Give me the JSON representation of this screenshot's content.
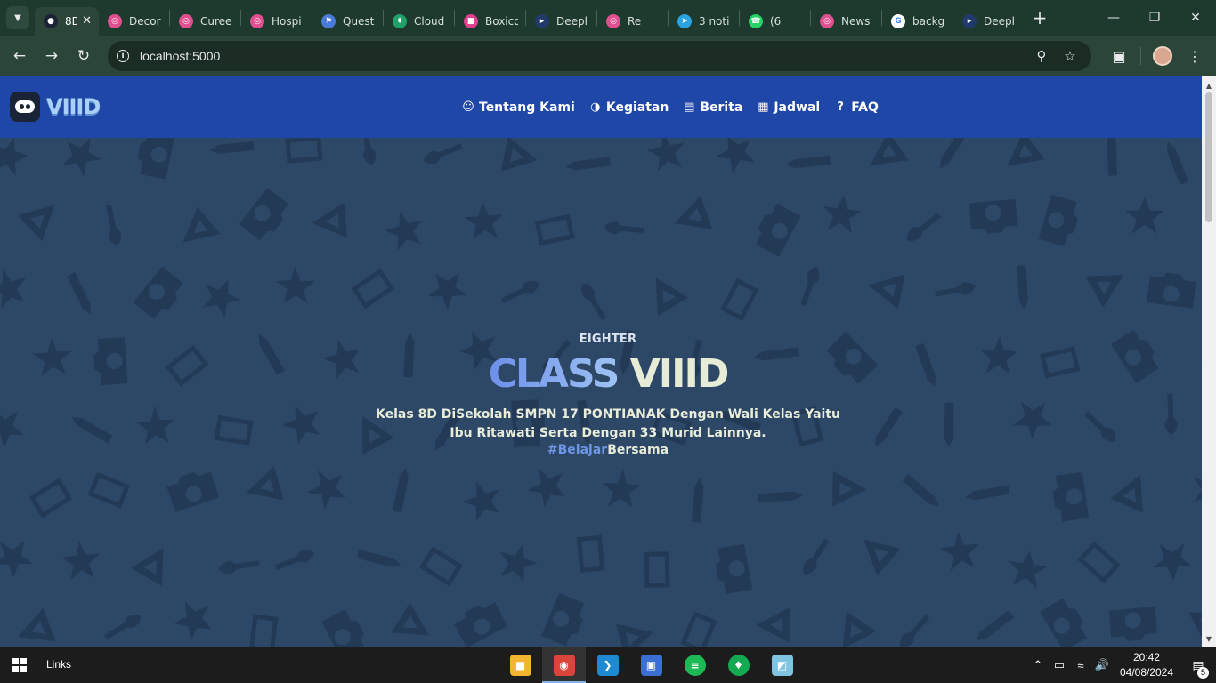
{
  "browser": {
    "tabs": [
      {
        "label": "8D",
        "color": "#1a2436",
        "glyph": "●",
        "active": true
      },
      {
        "label": "Decor",
        "color": "#e04f8f",
        "glyph": "◎"
      },
      {
        "label": "Curee",
        "color": "#e04f8f",
        "glyph": "◎"
      },
      {
        "label": "Hospi",
        "color": "#e04f8f",
        "glyph": "◎"
      },
      {
        "label": "Quest",
        "color": "#4b7bd8",
        "glyph": "⚑"
      },
      {
        "label": "Cloud",
        "color": "#22a06b",
        "glyph": "♦"
      },
      {
        "label": "Boxico",
        "color": "#e0408f",
        "glyph": "■"
      },
      {
        "label": "Deepl",
        "color": "#223a6a",
        "glyph": "▸"
      },
      {
        "label": "Re",
        "color": "#e04f8f",
        "glyph": "◎"
      },
      {
        "label": "3 noti",
        "color": "#2aa3e0",
        "glyph": "➤"
      },
      {
        "label": "(6",
        "color": "#25d366",
        "glyph": "☎"
      },
      {
        "label": "News",
        "color": "#e04f8f",
        "glyph": "◎"
      },
      {
        "label": "backg",
        "color": "#ffffff",
        "glyph": "G"
      },
      {
        "label": "Deepl",
        "color": "#223a6a",
        "glyph": "▸"
      }
    ],
    "url": "localhost:5000"
  },
  "site": {
    "logo_text": "VIIID",
    "menu": [
      {
        "icon": "☺",
        "label": "Tentang Kami",
        "name": "nav-tentang-kami"
      },
      {
        "icon": "◑",
        "label": "Kegiatan",
        "name": "nav-kegiatan"
      },
      {
        "icon": "▤",
        "label": "Berita",
        "name": "nav-berita"
      },
      {
        "icon": "▦",
        "label": "Jadwal",
        "name": "nav-jadwal"
      },
      {
        "icon": "?",
        "label": "FAQ",
        "name": "nav-faq"
      }
    ],
    "hero": {
      "eyebrow": "EIGHTER",
      "headline_1": "CLASS",
      "headline_2": "VIIID",
      "description": "Kelas 8D DiSekolah SMPN 17 PONTIANAK Dengan Wali Kelas Yaitu Ibu Ritawati Serta Dengan 33 Murid Lainnya.",
      "tag_1": "#Belajar",
      "tag_2": "Bersama"
    }
  },
  "taskbar": {
    "links_label": "Links",
    "apps": [
      {
        "name": "file-explorer",
        "color": "#f2b330",
        "glyph": "■"
      },
      {
        "name": "chrome",
        "color": "#d9453b",
        "glyph": "◉",
        "active": true
      },
      {
        "name": "vscode",
        "color": "#1f8ad2",
        "glyph": "❯"
      },
      {
        "name": "control-panel",
        "color": "#3b6fd1",
        "glyph": "▣"
      },
      {
        "name": "spotify",
        "color": "#1db954",
        "glyph": "≡"
      },
      {
        "name": "mongodb",
        "color": "#13aa52",
        "glyph": "♦"
      },
      {
        "name": "notes",
        "color": "#7fc4e0",
        "glyph": "◩"
      }
    ],
    "time": "20:42",
    "date": "04/08/2024",
    "notification_count": "5"
  },
  "colors": {
    "nav_bg": "#1f47a8",
    "hero_bg": "#2d4766",
    "accent": "#6f95e6"
  }
}
